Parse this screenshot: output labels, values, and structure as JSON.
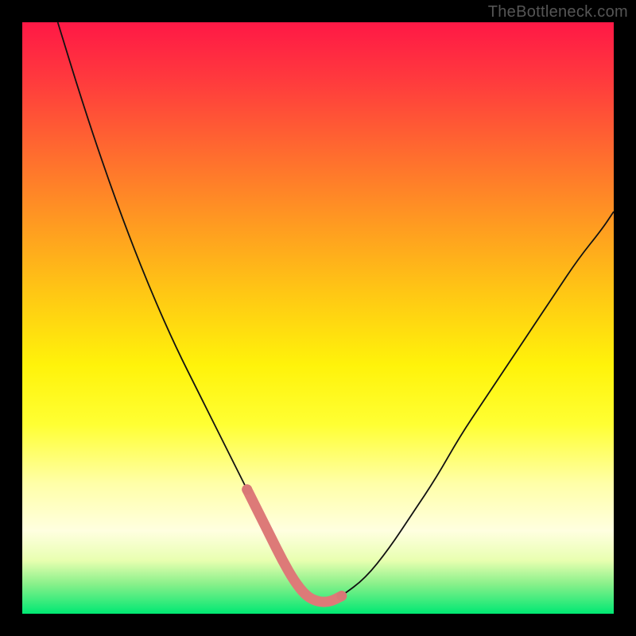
{
  "watermark": "TheBottleneck.com",
  "chart_data": {
    "type": "line",
    "title": "",
    "xlabel": "",
    "ylabel": "",
    "xlim": [
      0,
      100
    ],
    "ylim": [
      0,
      100
    ],
    "series": [
      {
        "name": "curve",
        "x": [
          6,
          10,
          14,
          18,
          22,
          26,
          30,
          34,
          38,
          40,
          42,
          44,
          46,
          48,
          50,
          52,
          54,
          58,
          62,
          66,
          70,
          74,
          78,
          82,
          86,
          90,
          94,
          98,
          100
        ],
        "values": [
          100,
          87,
          75,
          64,
          54,
          45,
          37,
          29,
          21,
          17,
          13,
          9,
          5.5,
          3,
          2,
          2,
          3,
          6,
          11,
          17,
          23,
          30,
          36,
          42,
          48,
          54,
          60,
          65,
          68
        ]
      }
    ],
    "highlight": {
      "range_x": [
        38,
        54
      ],
      "color": "#dd7a78"
    },
    "grid": false,
    "legend": false
  }
}
